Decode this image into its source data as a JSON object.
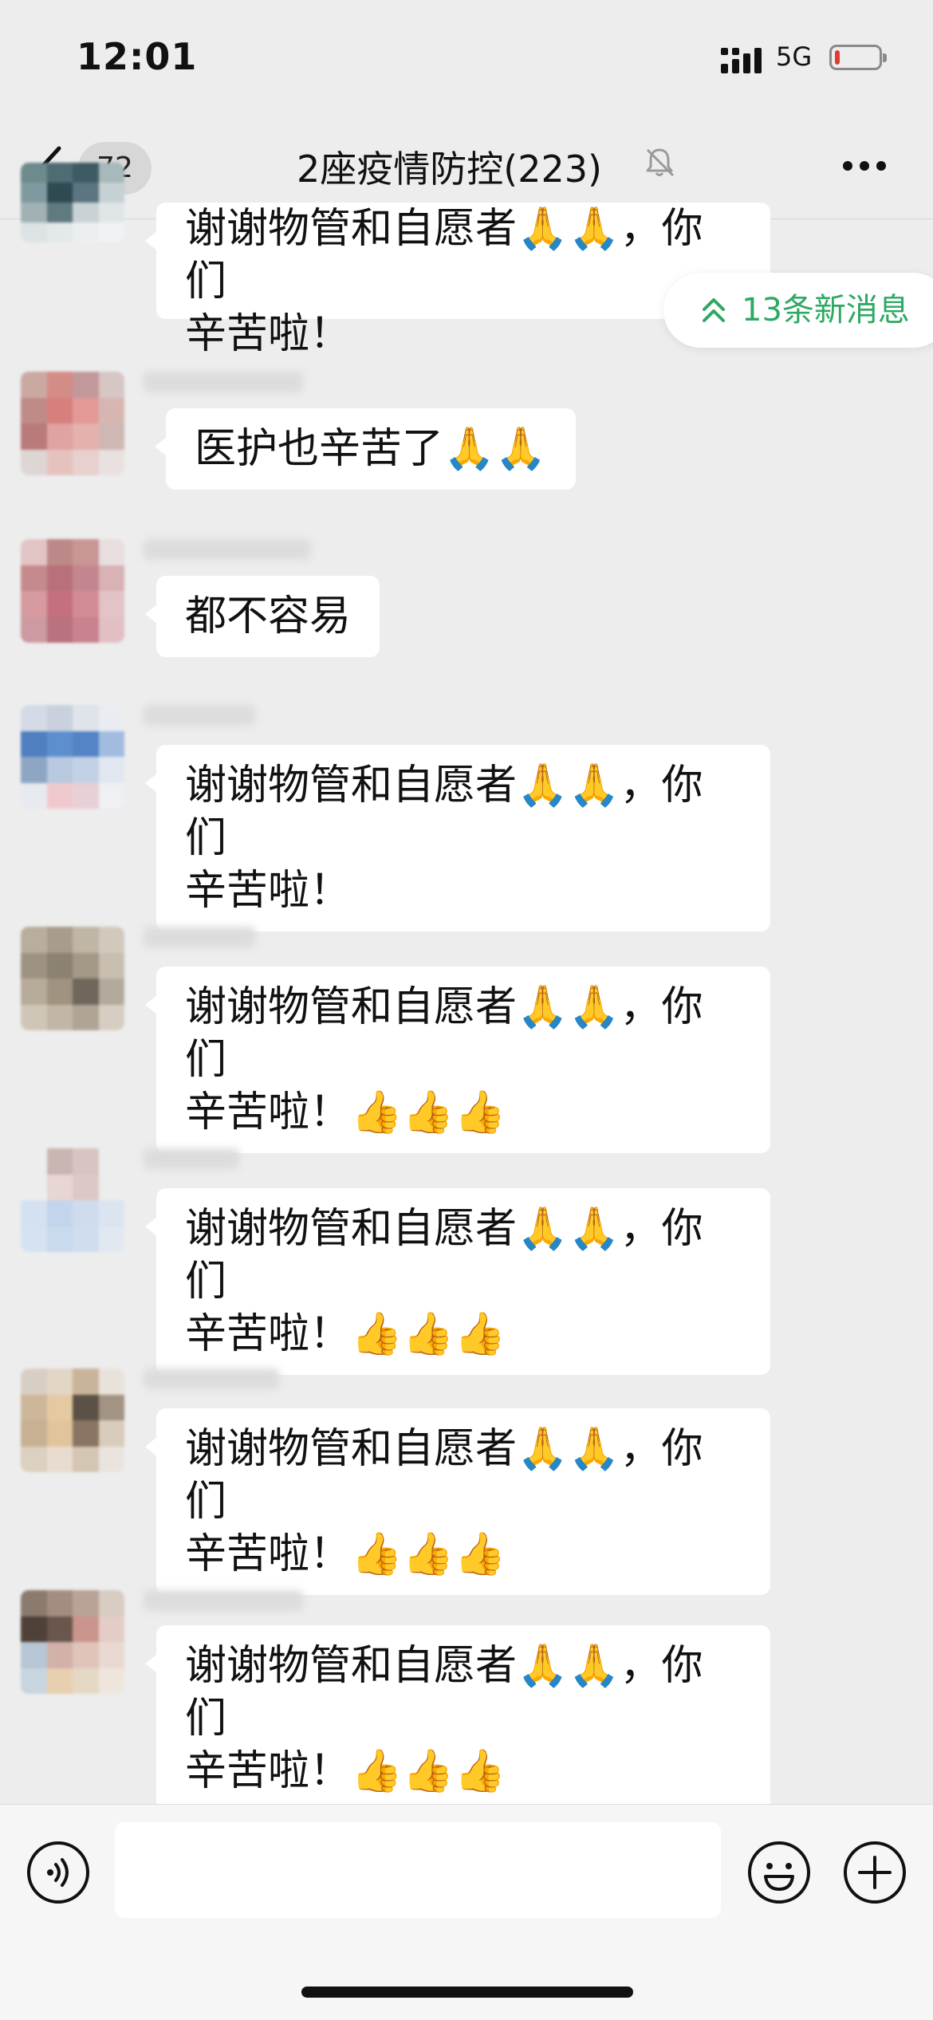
{
  "status_bar": {
    "time": "12:01",
    "network": "5G",
    "battery_level": 0.1
  },
  "nav": {
    "unread_count": "72",
    "title": "2座疫情防控(223)",
    "muted": true
  },
  "new_messages": {
    "label": "13条新消息"
  },
  "messages": [
    {
      "line1": "谢谢物管和自愿者🙏🙏，你们",
      "line2": "辛苦啦！"
    },
    {
      "line1": "医护也辛苦了🙏🙏"
    },
    {
      "line1": "都不容易"
    },
    {
      "line1": "谢谢物管和自愿者🙏🙏，你们",
      "line2": "辛苦啦！"
    },
    {
      "line1": "谢谢物管和自愿者🙏🙏，你们",
      "line2": "辛苦啦！👍👍👍"
    },
    {
      "line1": "谢谢物管和自愿者🙏🙏，你们",
      "line2": "辛苦啦！👍👍👍"
    },
    {
      "line1": "谢谢物管和自愿者🙏🙏，你们",
      "line2": "辛苦啦！👍👍👍"
    },
    {
      "line1": "谢谢物管和自愿者🙏🙏，你们",
      "line2": "辛苦啦！👍👍👍"
    }
  ],
  "colors": {
    "accent_green": "#2ea963",
    "background": "#ededed",
    "bubble": "#ffffff",
    "battery_low": "#e53935"
  },
  "icons": [
    "back-icon",
    "mute-bell-icon",
    "more-icon",
    "voice-icon",
    "emoji-icon",
    "plus-icon",
    "chevron-up-icon"
  ]
}
